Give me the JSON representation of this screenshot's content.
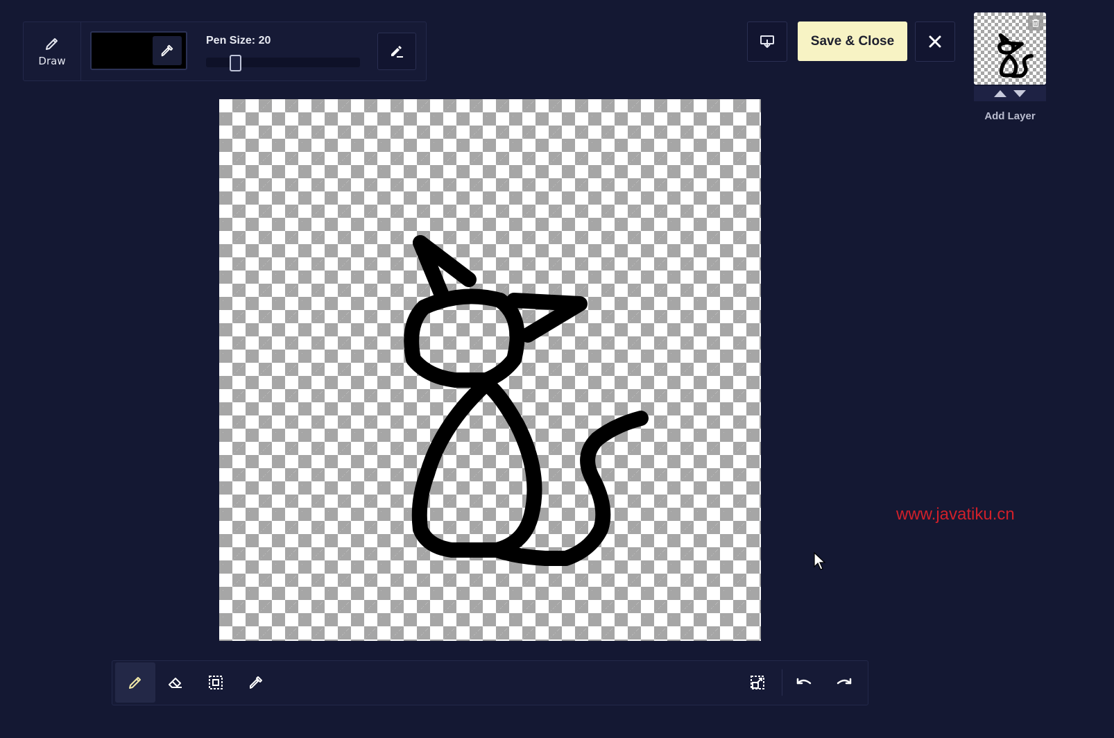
{
  "toolbar": {
    "draw_label": "Draw",
    "current_color": "#000000",
    "pen_size_label": "Pen Size: 20",
    "pen_size_value": 20
  },
  "actions": {
    "save_label": "Save & Close"
  },
  "layers": {
    "add_layer_label": "Add Layer"
  },
  "watermark": "www.javatiku.cn",
  "colors": {
    "background": "#141833",
    "save_button": "#f7f3c4",
    "watermark": "#d0202a"
  },
  "icons": {
    "draw": "pencil-icon",
    "picker": "eyedropper-icon",
    "pen_mode": "pen-line-icon",
    "download": "download-icon",
    "close": "close-icon",
    "trash": "trash-icon",
    "move_up": "triangle-up-icon",
    "move_down": "triangle-down-icon",
    "eraser": "eraser-icon",
    "select": "select-icon",
    "fit": "fit-canvas-icon",
    "undo": "undo-icon",
    "redo": "redo-icon"
  }
}
